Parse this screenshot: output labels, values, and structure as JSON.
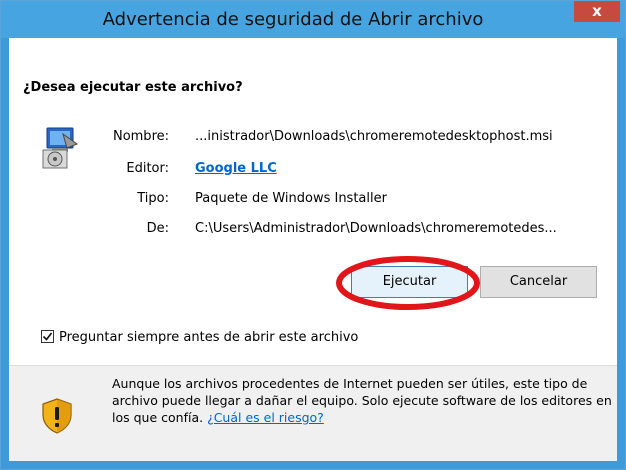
{
  "dialog": {
    "title": "Advertencia de seguridad de Abrir archivo",
    "close_label": "x",
    "question": "¿Desea ejecutar este archivo?",
    "fields": {
      "name_label": "Nombre:",
      "name_value": "...inistrador\\Downloads\\chromeremotedesktophost.msi",
      "publisher_label": "Editor:",
      "publisher_value": "Google LLC",
      "type_label": "Tipo:",
      "type_value": "Paquete de Windows Installer",
      "from_label": "De:",
      "from_value": "C:\\Users\\Administrador\\Downloads\\chromeremotedes..."
    },
    "buttons": {
      "run": "Ejecutar",
      "cancel": "Cancelar"
    },
    "checkbox": {
      "label": "Preguntar siempre antes de abrir este archivo",
      "checked": true
    },
    "warning": {
      "text": "Aunque los archivos procedentes de Internet pueden ser útiles, este tipo de archivo puede llegar a dañar el equipo. Solo ejecute software de los editores en los que confía. ",
      "link": "¿Cuál es el riesgo?"
    }
  },
  "icons": {
    "file": "installer-package-icon",
    "warning": "security-shield-icon"
  },
  "colors": {
    "titlebar": "#46a4e0",
    "close_button": "#c74a41",
    "link": "#0066cc",
    "highlight": "#e0161b"
  }
}
